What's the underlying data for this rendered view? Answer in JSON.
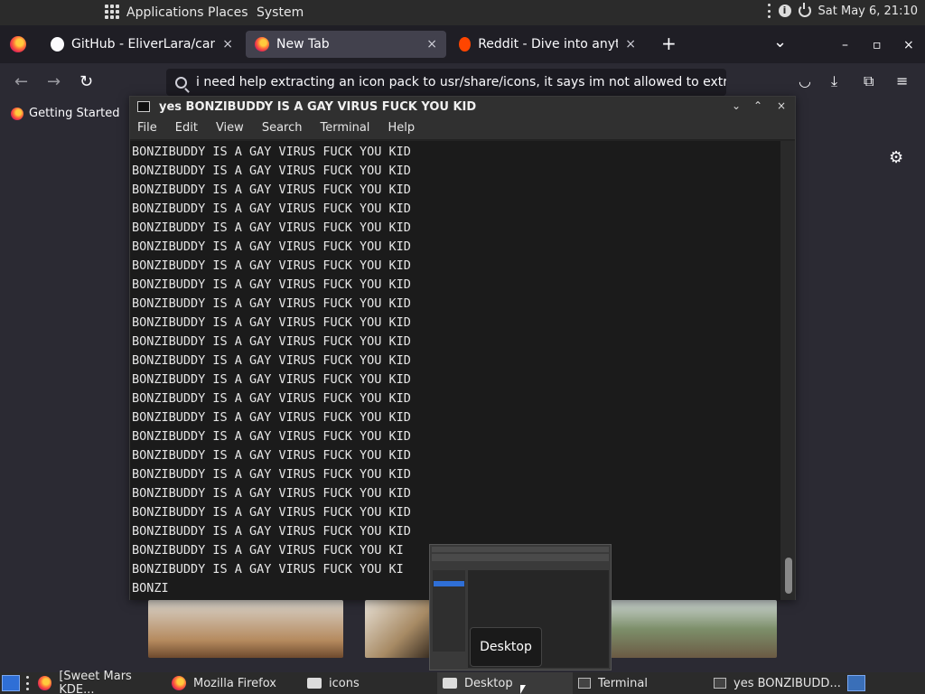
{
  "top_panel": {
    "menus": [
      "Applications",
      "Places",
      "System"
    ],
    "clock": "Sat May  6, 21:10",
    "icons": [
      "apps-grid-icon",
      "kebab-icon",
      "info-icon",
      "power-icon"
    ]
  },
  "browser": {
    "tabs": [
      {
        "title": "GitHub - EliverLara/candy-i",
        "icon": "github-icon",
        "close": "×"
      },
      {
        "title": "New Tab",
        "icon": "firefox-icon",
        "close": "×"
      },
      {
        "title": "Reddit - Dive into anything",
        "icon": "reddit-icon",
        "close": "×"
      }
    ],
    "new_tab": "+",
    "tab_list": "⌄",
    "window_controls": [
      "–",
      "▫",
      "×"
    ],
    "url": "i need help extracting an icon pack to usr/share/icons, it says im not allowed to extract to",
    "bookmark": "Getting Started"
  },
  "terminal": {
    "title": "yes BONZIBUDDY IS A GAY VIRUS FUCK YOU KID",
    "menus": [
      "File",
      "Edit",
      "View",
      "Search",
      "Terminal",
      "Help"
    ],
    "controls": [
      "⌄",
      "⌃",
      "×"
    ],
    "lines": [
      "BONZIBUDDY IS A GAY VIRUS FUCK YOU KID",
      "BONZIBUDDY IS A GAY VIRUS FUCK YOU KID",
      "BONZIBUDDY IS A GAY VIRUS FUCK YOU KID",
      "BONZIBUDDY IS A GAY VIRUS FUCK YOU KID",
      "BONZIBUDDY IS A GAY VIRUS FUCK YOU KID",
      "BONZIBUDDY IS A GAY VIRUS FUCK YOU KID",
      "BONZIBUDDY IS A GAY VIRUS FUCK YOU KID",
      "BONZIBUDDY IS A GAY VIRUS FUCK YOU KID",
      "BONZIBUDDY IS A GAY VIRUS FUCK YOU KID",
      "BONZIBUDDY IS A GAY VIRUS FUCK YOU KID",
      "BONZIBUDDY IS A GAY VIRUS FUCK YOU KID",
      "BONZIBUDDY IS A GAY VIRUS FUCK YOU KID",
      "BONZIBUDDY IS A GAY VIRUS FUCK YOU KID",
      "BONZIBUDDY IS A GAY VIRUS FUCK YOU KID",
      "BONZIBUDDY IS A GAY VIRUS FUCK YOU KID",
      "BONZIBUDDY IS A GAY VIRUS FUCK YOU KID",
      "BONZIBUDDY IS A GAY VIRUS FUCK YOU KID",
      "BONZIBUDDY IS A GAY VIRUS FUCK YOU KID",
      "BONZIBUDDY IS A GAY VIRUS FUCK YOU KID",
      "BONZIBUDDY IS A GAY VIRUS FUCK YOU KID",
      "BONZIBUDDY IS A GAY VIRUS FUCK YOU KID",
      "BONZIBUDDY IS A GAY VIRUS FUCK YOU KI",
      "BONZIBUDDY IS A GAY VIRUS FUCK YOU KI",
      "BONZI"
    ]
  },
  "preview_tooltip": "Desktop",
  "taskbar": {
    "tasks": [
      {
        "label": "[Sweet Mars KDE...",
        "icon": "firefox-icon"
      },
      {
        "label": "Mozilla Firefox",
        "icon": "firefox-icon"
      },
      {
        "label": "icons",
        "icon": "folder-icon"
      },
      {
        "label": "Desktop",
        "icon": "folder-icon"
      },
      {
        "label": "Terminal",
        "icon": "terminal-icon"
      },
      {
        "label": "yes BONZIBUDD...",
        "icon": "terminal-icon"
      }
    ]
  },
  "colors": {
    "accent": "#2f6fd6",
    "reddit": "#ff4500"
  }
}
